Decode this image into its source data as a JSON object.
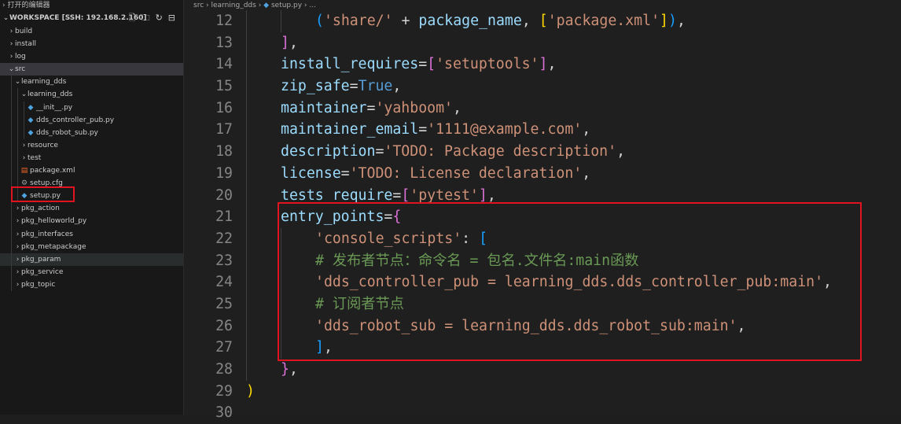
{
  "explorer": {
    "open_editors_label": "打开的编辑器",
    "workspace_title": "WORKSPACE [SSH: 192.168.2.160]",
    "tree": [
      {
        "label": "build",
        "kind": "folder",
        "depth": 0,
        "expanded": false
      },
      {
        "label": "install",
        "kind": "folder",
        "depth": 0,
        "expanded": false
      },
      {
        "label": "log",
        "kind": "folder",
        "depth": 0,
        "expanded": false
      },
      {
        "label": "src",
        "kind": "folder",
        "depth": 0,
        "expanded": true,
        "selected": true
      },
      {
        "label": "learning_dds",
        "kind": "folder",
        "depth": 1,
        "expanded": true
      },
      {
        "label": "learning_dds",
        "kind": "folder",
        "depth": 2,
        "expanded": true
      },
      {
        "label": "__init__.py",
        "kind": "py",
        "depth": 3
      },
      {
        "label": "dds_controller_pub.py",
        "kind": "py",
        "depth": 3
      },
      {
        "label": "dds_robot_sub.py",
        "kind": "py",
        "depth": 3
      },
      {
        "label": "resource",
        "kind": "folder",
        "depth": 2,
        "expanded": false
      },
      {
        "label": "test",
        "kind": "folder",
        "depth": 2,
        "expanded": false
      },
      {
        "label": "package.xml",
        "kind": "xml",
        "depth": 2
      },
      {
        "label": "setup.cfg",
        "kind": "cfg",
        "depth": 2
      },
      {
        "label": "setup.py",
        "kind": "py",
        "depth": 2,
        "highlighted": true
      },
      {
        "label": "pkg_action",
        "kind": "folder",
        "depth": 1,
        "expanded": false
      },
      {
        "label": "pkg_helloworld_py",
        "kind": "folder",
        "depth": 1,
        "expanded": false
      },
      {
        "label": "pkg_interfaces",
        "kind": "folder",
        "depth": 1,
        "expanded": false
      },
      {
        "label": "pkg_metapackage",
        "kind": "folder",
        "depth": 1,
        "expanded": false
      },
      {
        "label": "pkg_param",
        "kind": "folder",
        "depth": 1,
        "expanded": false,
        "hover": true
      },
      {
        "label": "pkg_service",
        "kind": "folder",
        "depth": 1,
        "expanded": false
      },
      {
        "label": "pkg_topic",
        "kind": "folder",
        "depth": 1,
        "expanded": false
      }
    ]
  },
  "breadcrumb": [
    "src",
    "learning_dds",
    "setup.py",
    "..."
  ],
  "colors": {
    "highlight_box": "#e0141e",
    "py_icon": "#4fa3e0",
    "xml_icon": "#f1662a"
  },
  "code_lines": [
    {
      "num": "12",
      "indent": 2,
      "tokens": [
        [
          "(",
          "b3"
        ],
        [
          "'share/'",
          "str"
        ],
        [
          " + ",
          "op"
        ],
        [
          "package_name",
          "var"
        ],
        [
          ", ",
          "op"
        ],
        [
          "[",
          "b1"
        ],
        [
          "'package.xml'",
          "str"
        ],
        [
          "]",
          "b1"
        ],
        [
          ")",
          "b3"
        ],
        [
          ",",
          "op"
        ]
      ]
    },
    {
      "num": "13",
      "indent": 1,
      "tokens": [
        [
          "]",
          "b2"
        ],
        [
          ",",
          "op"
        ]
      ]
    },
    {
      "num": "14",
      "indent": 1,
      "tokens": [
        [
          "install_requires",
          "var"
        ],
        [
          "=",
          "op"
        ],
        [
          "[",
          "b2"
        ],
        [
          "'setuptools'",
          "str"
        ],
        [
          "]",
          "b2"
        ],
        [
          ",",
          "op"
        ]
      ]
    },
    {
      "num": "15",
      "indent": 1,
      "tokens": [
        [
          "zip_safe",
          "var"
        ],
        [
          "=",
          "op"
        ],
        [
          "True",
          "kw"
        ],
        [
          ",",
          "op"
        ]
      ]
    },
    {
      "num": "16",
      "indent": 1,
      "tokens": [
        [
          "maintainer",
          "var"
        ],
        [
          "=",
          "op"
        ],
        [
          "'yahboom'",
          "str"
        ],
        [
          ",",
          "op"
        ]
      ]
    },
    {
      "num": "17",
      "indent": 1,
      "tokens": [
        [
          "maintainer_email",
          "var"
        ],
        [
          "=",
          "op"
        ],
        [
          "'1111@example.com'",
          "str"
        ],
        [
          ",",
          "op"
        ]
      ]
    },
    {
      "num": "18",
      "indent": 1,
      "tokens": [
        [
          "description",
          "var"
        ],
        [
          "=",
          "op"
        ],
        [
          "'TODO: Package description'",
          "str"
        ],
        [
          ",",
          "op"
        ]
      ]
    },
    {
      "num": "19",
      "indent": 1,
      "tokens": [
        [
          "license",
          "var"
        ],
        [
          "=",
          "op"
        ],
        [
          "'TODO: License declaration'",
          "str"
        ],
        [
          ",",
          "op"
        ]
      ]
    },
    {
      "num": "20",
      "indent": 1,
      "tokens": [
        [
          "tests_require",
          "var"
        ],
        [
          "=",
          "op"
        ],
        [
          "[",
          "b2"
        ],
        [
          "'pytest'",
          "str"
        ],
        [
          "]",
          "b2"
        ],
        [
          ",",
          "op"
        ]
      ]
    },
    {
      "num": "21",
      "indent": 1,
      "tokens": [
        [
          "entry_points",
          "var"
        ],
        [
          "=",
          "op"
        ],
        [
          "{",
          "b2"
        ]
      ]
    },
    {
      "num": "22",
      "indent": 2,
      "tokens": [
        [
          "'console_scripts'",
          "str"
        ],
        [
          ": ",
          "op"
        ],
        [
          "[",
          "b3"
        ]
      ]
    },
    {
      "num": "23",
      "indent": 2,
      "tokens": [
        [
          "# 发布者节点：命令名 = 包名.文件名:main函数",
          "cmt"
        ]
      ]
    },
    {
      "num": "24",
      "indent": 2,
      "tokens": [
        [
          "'dds_controller_pub = learning_dds.dds_controller_pub:main'",
          "str"
        ],
        [
          ",",
          "op"
        ]
      ]
    },
    {
      "num": "25",
      "indent": 2,
      "tokens": [
        [
          "# 订阅者节点",
          "cmt"
        ]
      ]
    },
    {
      "num": "26",
      "indent": 2,
      "tokens": [
        [
          "'dds_robot_sub = learning_dds.dds_robot_sub:main'",
          "str"
        ],
        [
          ",",
          "op"
        ]
      ]
    },
    {
      "num": "27",
      "indent": 2,
      "tokens": [
        [
          "]",
          "b3"
        ],
        [
          ",",
          "op"
        ]
      ]
    },
    {
      "num": "28",
      "indent": 1,
      "tokens": [
        [
          "}",
          "b2"
        ],
        [
          ",",
          "op"
        ]
      ]
    },
    {
      "num": "29",
      "indent": 0,
      "tokens": [
        [
          ")",
          "b1"
        ]
      ]
    },
    {
      "num": "30",
      "indent": 0,
      "tokens": []
    }
  ]
}
